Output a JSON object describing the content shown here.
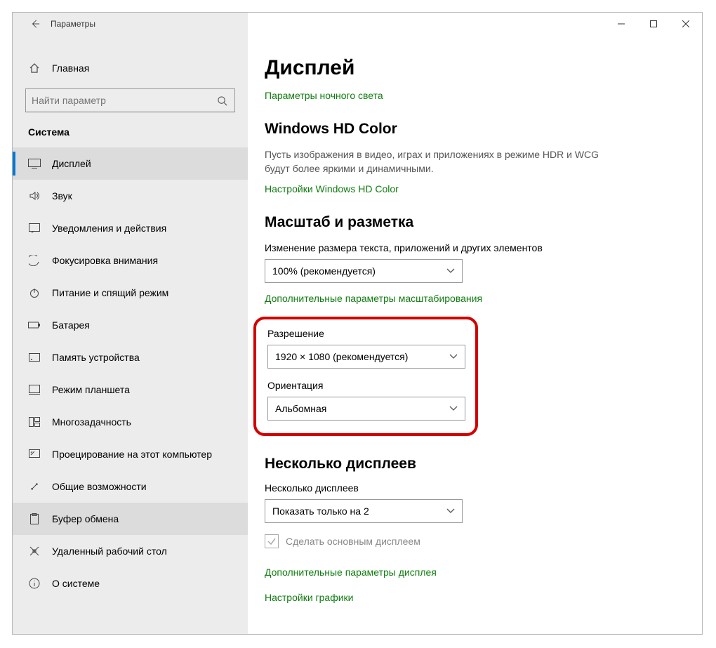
{
  "window": {
    "title": "Параметры"
  },
  "sidebar": {
    "home": "Главная",
    "search_placeholder": "Найти параметр",
    "group": "Система",
    "items": [
      {
        "label": "Дисплей"
      },
      {
        "label": "Звук"
      },
      {
        "label": "Уведомления и действия"
      },
      {
        "label": "Фокусировка внимания"
      },
      {
        "label": "Питание и спящий режим"
      },
      {
        "label": "Батарея"
      },
      {
        "label": "Память устройства"
      },
      {
        "label": "Режим планшета"
      },
      {
        "label": "Многозадачность"
      },
      {
        "label": "Проецирование на этот компьютер"
      },
      {
        "label": "Общие возможности"
      },
      {
        "label": "Буфер обмена"
      },
      {
        "label": "Удаленный рабочий стол"
      },
      {
        "label": "О системе"
      }
    ]
  },
  "content": {
    "title": "Дисплей",
    "night_light_link": "Параметры ночного света",
    "hdcolor_heading": "Windows HD Color",
    "hdcolor_desc": "Пусть изображения в видео, играх и приложениях в режиме HDR и WCG будут более яркими и динамичными.",
    "hdcolor_link": "Настройки Windows HD Color",
    "scale_heading": "Масштаб и разметка",
    "scale_label": "Изменение размера текста, приложений и других элементов",
    "scale_value": "100% (рекомендуется)",
    "scale_link": "Дополнительные параметры масштабирования",
    "resolution_label": "Разрешение",
    "resolution_value": "1920 × 1080 (рекомендуется)",
    "orientation_label": "Ориентация",
    "orientation_value": "Альбомная",
    "multi_heading": "Несколько дисплеев",
    "multi_label": "Несколько дисплеев",
    "multi_value": "Показать только на 2",
    "make_main_label": "Сделать основным дисплеем",
    "adv_display_link": "Дополнительные параметры дисплея",
    "graphics_link": "Настройки графики"
  }
}
